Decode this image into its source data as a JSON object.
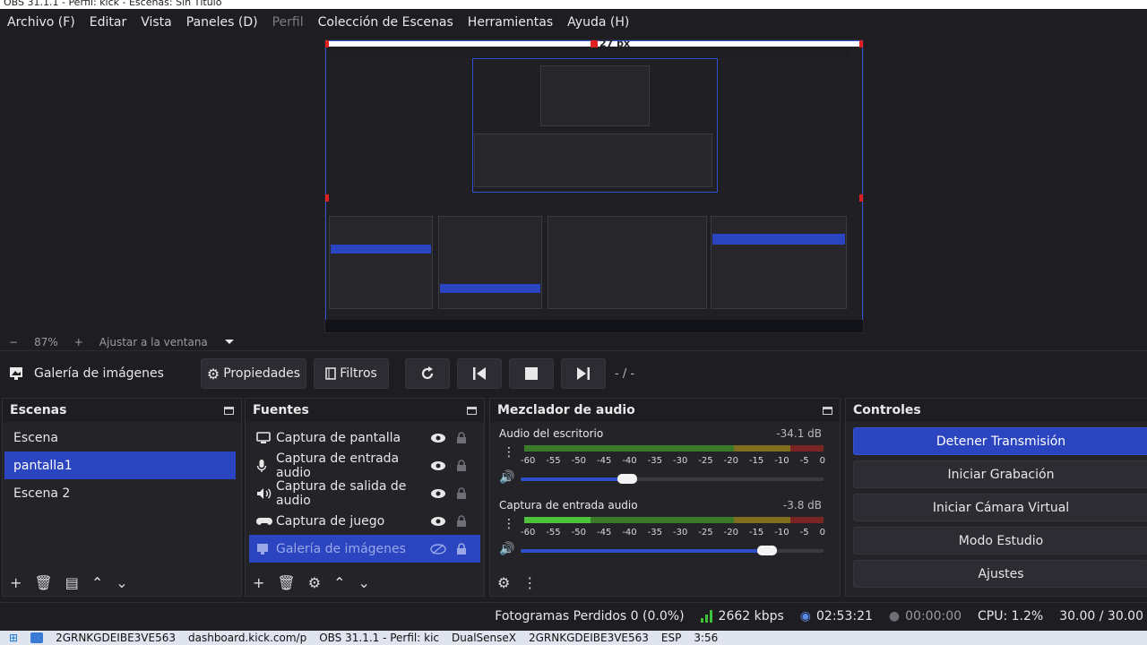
{
  "window": {
    "title": "OBS 31.1.1 - Perfil: kick - Escenas: Sin Título"
  },
  "menu": [
    {
      "label": "Archivo (F)",
      "disabled": false
    },
    {
      "label": "Editar",
      "disabled": false
    },
    {
      "label": "Vista",
      "disabled": false
    },
    {
      "label": "Paneles (D)",
      "disabled": false
    },
    {
      "label": "Perfil",
      "disabled": true
    },
    {
      "label": "Colección de Escenas",
      "disabled": false
    },
    {
      "label": "Herramientas",
      "disabled": false
    },
    {
      "label": "Ayuda (H)",
      "disabled": false
    }
  ],
  "preview": {
    "measure_label": "27 px"
  },
  "zoom": {
    "minus": "−",
    "value": "87%",
    "plus": "+",
    "fit_label": "Ajustar a la ventana"
  },
  "source_toolbar": {
    "source_name": "Galería de imágenes",
    "properties_label": "Propiedades",
    "filters_label": "Filtros",
    "counter": "- / -"
  },
  "scenes": {
    "title": "Escenas",
    "items": [
      {
        "label": "Escena",
        "selected": false
      },
      {
        "label": "pantalla1",
        "selected": true
      },
      {
        "label": "Escena 2",
        "selected": false
      }
    ]
  },
  "sources": {
    "title": "Fuentes",
    "items": [
      {
        "label": "Captura de pantalla",
        "icon": "monitor-icon",
        "visible": true,
        "selected": false
      },
      {
        "label": "Captura de entrada audio",
        "icon": "microphone-icon",
        "visible": true,
        "selected": false
      },
      {
        "label": "Captura de salida de audio",
        "icon": "speaker-icon",
        "visible": true,
        "selected": false
      },
      {
        "label": "Captura de juego",
        "icon": "gamepad-icon",
        "visible": true,
        "selected": false
      },
      {
        "label": "Galería de imágenes",
        "icon": "image-gallery-icon",
        "visible": false,
        "selected": true
      }
    ]
  },
  "mixer": {
    "title": "Mezclador de audio",
    "ticks": [
      "-60",
      "-55",
      "-50",
      "-45",
      "-40",
      "-35",
      "-30",
      "-25",
      "-20",
      "-15",
      "-10",
      "-5",
      "0"
    ],
    "channels": [
      {
        "name": "Audio del escritorio",
        "db": "-34.1 dB",
        "level_fraction": 0.0,
        "volume_fraction": 0.34
      },
      {
        "name": "Captura de entrada audio",
        "db": "-3.8 dB",
        "level_fraction": 0.22,
        "volume_fraction": 0.8
      }
    ]
  },
  "controls": {
    "title": "Controles",
    "buttons": [
      {
        "label": "Detener Transmisión",
        "active": true
      },
      {
        "label": "Iniciar Grabación",
        "active": false
      },
      {
        "label": "Iniciar Cámara Virtual",
        "active": false
      },
      {
        "label": "Modo Estudio",
        "active": false
      },
      {
        "label": "Ajustes",
        "active": false
      }
    ]
  },
  "status": {
    "dropped_frames": "Fotogramas Perdidos 0 (0.0%)",
    "bitrate": "2662 kbps",
    "stream_time": "02:53:21",
    "record_time": "00:00:00",
    "cpu": "CPU: 1.2%",
    "fps": "30.00 / 30.00"
  },
  "os_taskbar": {
    "items": [
      "2GRNKGDEIBE3VE563",
      "dashboard.kick.com/p",
      "OBS 31.1.1 - Perfil: kic",
      "DualSenseX",
      "2GRNKGDEIBE3VE563"
    ],
    "lang": "ESP",
    "clock": "3:56"
  },
  "colors": {
    "accent": "#2b44c0",
    "background": "#1e1e22",
    "dock": "#232328"
  }
}
